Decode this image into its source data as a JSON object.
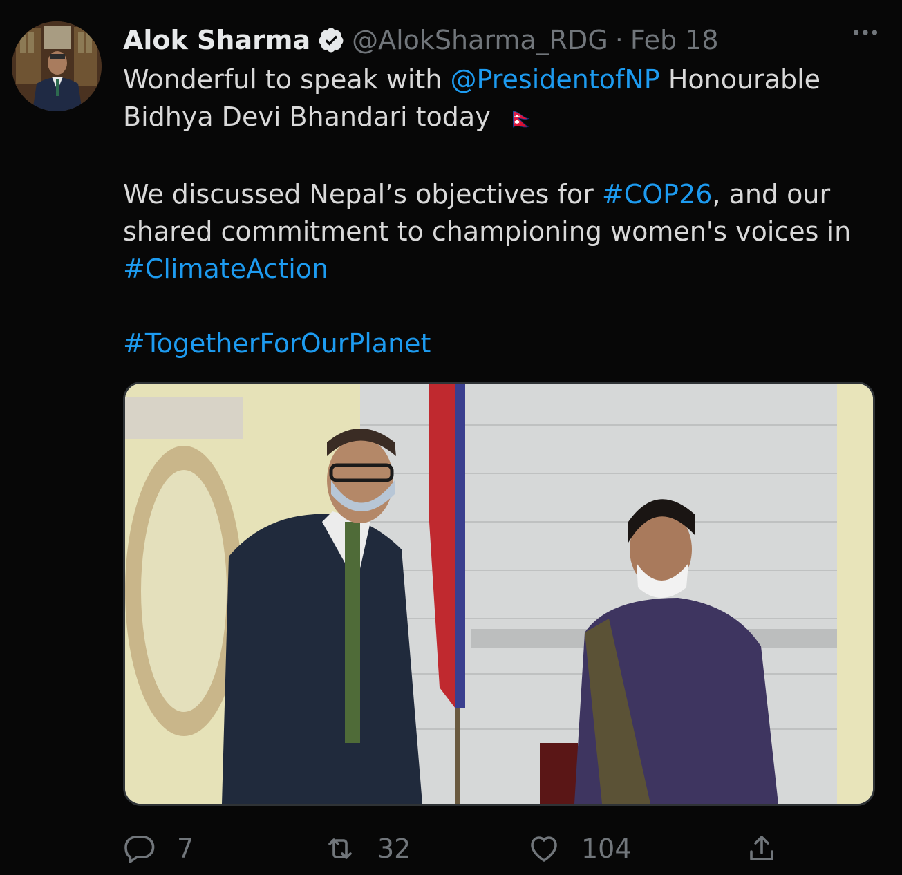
{
  "author": {
    "name": "Alok Sharma",
    "handle": "@AlokSharma_RDG",
    "separator": "·",
    "date": "Feb 18"
  },
  "tweet": {
    "line1_a": "Wonderful to speak with ",
    "line1_mention": "@PresidentofNP",
    "line1_b": " Honourable",
    "line2": "Bidhya Devi Bhandari today",
    "line2_flag": "🇳🇵",
    "para2_a": "We discussed Nepal’s objectives for ",
    "para2_tag1": "#COP26",
    "para2_b": ", and our",
    "para2_line2": "shared commitment to championing women's voices in",
    "para2_tag2": "#ClimateAction",
    "para3_tag": "#TogetherForOurPlanet"
  },
  "stats": {
    "replies": "7",
    "retweets": "32",
    "likes": "104"
  },
  "colors": {
    "link": "#1d9bf0",
    "muted": "#71767b",
    "background": "#070707"
  },
  "icons": {
    "more": "more-icon",
    "verified": "verified-icon",
    "reply": "reply-icon",
    "retweet": "retweet-icon",
    "like": "heart-icon",
    "share": "share-icon"
  }
}
